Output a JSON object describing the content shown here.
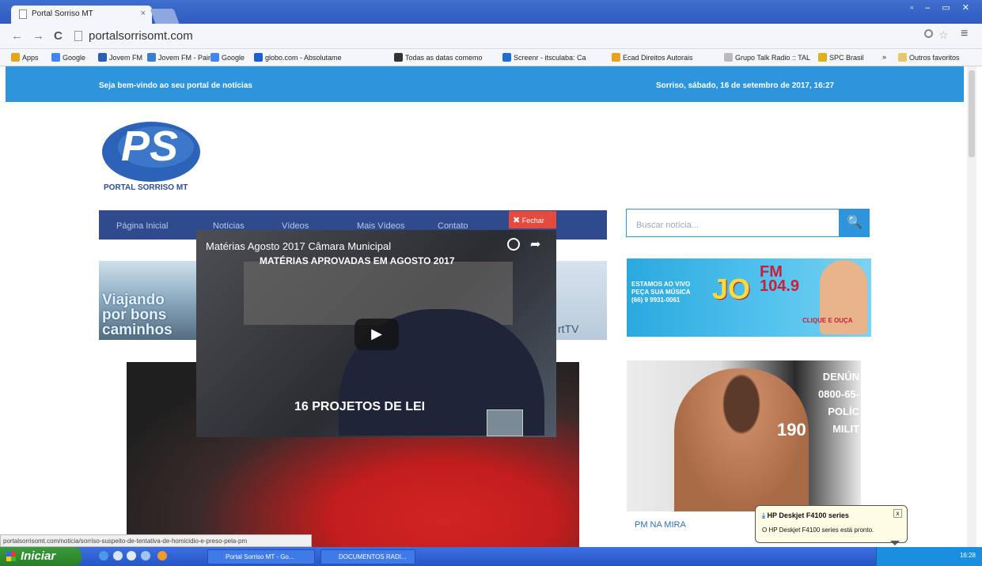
{
  "browser": {
    "tab_title": "Portal Sorriso MT",
    "tab_close": "×",
    "window_controls": "▫ ‒ ▭ ✕",
    "back": "←",
    "forward": "→",
    "reload": "C",
    "url": "portalsorrisomt.com",
    "menu_icon": "≡",
    "bookmarks": [
      {
        "label": "Apps",
        "color": "#e5a41b"
      },
      {
        "label": "Google",
        "color": "#4285f4"
      },
      {
        "label": "Jovem FM",
        "color": "#2a5fb8"
      },
      {
        "label": "Jovem FM - Painel",
        "color": "#3b7fd0"
      },
      {
        "label": "Google",
        "color": "#4285f4"
      },
      {
        "label": "globo.com - Absolutame",
        "color": "#1f5fd4"
      },
      {
        "label": "Todas as datas comemo",
        "color": "#333333"
      },
      {
        "label": "Screenr - itsculaba: Ca",
        "color": "#1f6fd4"
      },
      {
        "label": "Ecad Direitos Autorais",
        "color": "#e5a41b"
      },
      {
        "label": "Grupo Talk Radio :: TAL",
        "color": "#bbbbbb"
      },
      {
        "label": "SPC Brasil",
        "color": "#d9b21c"
      }
    ],
    "bookmarks_overflow": "»",
    "other_bookmarks": "Outros favoritos"
  },
  "site": {
    "welcome": "Seja bem-vindo ao seu portal de notícias",
    "datetime": "Sorriso, sábado, 16 de setembro de 2017, 16:27",
    "logo_letters": "PS",
    "logo_text": "PORTAL SORRISO MT",
    "menu": [
      "Página Inicial",
      "Notícias",
      "Vídeos",
      "Mais Vídeos",
      "Contato"
    ],
    "search_placeholder": "Buscar notícia...",
    "ad_left_text": "Viajando\npor bons\ncaminhos",
    "ad_right_text": "rtTV",
    "radio_ad": {
      "line1": "ESTAMOS AO VIVO\nPEÇA SUA MÚSICA\n(66) 9 9931-0061",
      "brand": "JO",
      "fm": "FM\n104.9",
      "cta": "CLIQUE E OUÇA"
    },
    "police_image_text": "DENÚN\n0800-65-\nPOLÍC\nMILIT",
    "police_image_number": "190",
    "news_link": "PM NA MIRA"
  },
  "video": {
    "title": "Matérias Agosto 2017 Câmara Municipal",
    "subtitle": "MATÉRIAS APROVADAS EM AGOSTO 2017",
    "caption": "16 PROJETOS DE LEI",
    "play": "▶",
    "share": "➦",
    "close": "Fechar",
    "close_icon": "✖"
  },
  "status_url": "portalsorrisomt.com/noticia/sorriso-suspeito-de-tentativa-de-homicidio-e-preso-pela-pm",
  "notification": {
    "title": "HP Deskjet F4100 series",
    "message": "O HP Deskjet F4100 series está pronto.",
    "close": "x"
  },
  "taskbar": {
    "start": "Iniciar",
    "tasks": [
      "Portal Sorriso MT - Go...",
      "DOCUMENTOS RADI..."
    ],
    "clock": "16:28"
  }
}
